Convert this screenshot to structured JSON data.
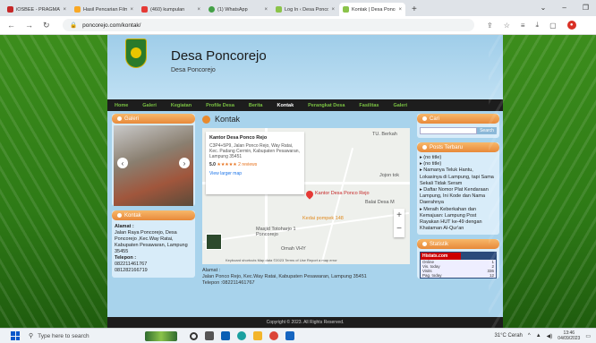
{
  "browser": {
    "tabs": [
      {
        "label": "iOSBEE - PRAGMATIC",
        "color": "#c62828"
      },
      {
        "label": "Hasil Pencarian Film",
        "color": "#f9a825"
      },
      {
        "label": "(460) kumpulan",
        "color": "#e53935"
      },
      {
        "label": "(1) WhatsApp",
        "color": "#43a047"
      },
      {
        "label": "Log In ‹ Desa Poncoreji",
        "color": "#8bc34a"
      },
      {
        "label": "Kontak | Desa Poncore",
        "color": "#8bc34a"
      }
    ],
    "url": "poncorejo.com/kontak/"
  },
  "site": {
    "name": "Desa Poncorejo",
    "tagline": "Desa Poncorejo",
    "menu": [
      "Home",
      "Galeri",
      "Kegiatan",
      "Profile Desa",
      "Berita",
      "Kontak",
      "Perangkat Desa",
      "Fasilitas",
      "Galeri"
    ],
    "active_menu": "Kontak",
    "left": {
      "galeri_title": "Galeri",
      "kontak_title": "Kontak",
      "alamat_label": "Alamat :",
      "alamat_text": "Jalan Raya Poncorejo, Desa Poncorejo ,Kec.Way Ratai, Kabupaten Pesawaran, Lampung 35455",
      "telepon_label": "Telepon :",
      "phone1": "082211461767",
      "phone2": "081282166719"
    },
    "main": {
      "title": "Kontak",
      "map": {
        "place_name": "Kantor Desa Ponco Rejo",
        "place_address": "C3P4+5P9, Jalan Ponco Rejo, Way Ratai, Kec. Padang Cermin, Kabupaten Pesawaran, Lampung 35451",
        "rating": "5.0",
        "stars": "★★★★★",
        "reviews": "2 reviews",
        "view_larger": "View larger map",
        "pin_label": "Kantor Desa Ponco Rejo",
        "labels": [
          "Kedai pompek 148",
          "Balai Desa M",
          "Masjid Totoharjo 1 Poncorejo",
          "Omah VHY",
          "Jojon tok",
          "TU. Berkah"
        ],
        "footer": "Keyboard shortcuts   Map data ©2023   Terms of Use   Report a map error"
      },
      "alamat_line": "Alamat :",
      "alamat": "Jalan Ponco Rejo, Kec.Way Ratai, Kabupaten Pesawaran, Lampung 35451",
      "telepon": "Telepon :082211461767"
    },
    "right": {
      "cari_title": "Cari",
      "search_button": "Search",
      "posts_title": "Posts Terbaru",
      "posts": [
        "(no title)",
        "(no title)",
        "Namanya Teluk Hantu, Lokasinya di Lampung, tapi Sama Sekali Tidak Seram",
        "Daftar Nomor Plat Kendaraan Lampung, Ini Kode dan Nama Daerahnya",
        "Meraih Keberkahan dan Kemajuan: Lampung Post Rayakan HUT ke-49 dengan Khataman Al-Qur'an"
      ],
      "statistik_title": "Statistik",
      "histats": "Histats.com",
      "stats": [
        {
          "label": "Online",
          "value": "1"
        },
        {
          "label": "Vis. today",
          "value": "2"
        },
        {
          "label": "Visits",
          "value": "336"
        },
        {
          "label": "Pag. today",
          "value": "12"
        }
      ]
    },
    "footer": "Copyright © 2023. All Rights Reserved."
  },
  "taskbar": {
    "search_placeholder": "Type here to search",
    "weather": "31°C  Cerah",
    "time": "13:46",
    "date": "04/09/2023"
  }
}
